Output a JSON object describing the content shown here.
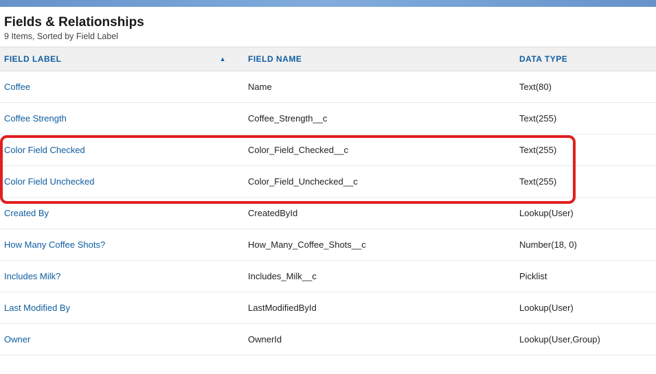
{
  "header": {
    "title": "Fields & Relationships",
    "subtitle": "9 Items, Sorted by Field Label"
  },
  "columns": {
    "label": "FIELD LABEL",
    "name": "FIELD NAME",
    "type": "DATA TYPE"
  },
  "rows": [
    {
      "label": "Coffee",
      "name": "Name",
      "type": "Text(80)"
    },
    {
      "label": "Coffee Strength",
      "name": "Coffee_Strength__c",
      "type": "Text(255)"
    },
    {
      "label": "Color Field Checked",
      "name": "Color_Field_Checked__c",
      "type": "Text(255)"
    },
    {
      "label": "Color Field Unchecked",
      "name": "Color_Field_Unchecked__c",
      "type": "Text(255)"
    },
    {
      "label": "Created By",
      "name": "CreatedById",
      "type": "Lookup(User)"
    },
    {
      "label": "How Many Coffee Shots?",
      "name": "How_Many_Coffee_Shots__c",
      "type": "Number(18, 0)"
    },
    {
      "label": "Includes Milk?",
      "name": "Includes_Milk__c",
      "type": "Picklist"
    },
    {
      "label": "Last Modified By",
      "name": "LastModifiedById",
      "type": "Lookup(User)"
    },
    {
      "label": "Owner",
      "name": "OwnerId",
      "type": "Lookup(User,Group)"
    }
  ]
}
